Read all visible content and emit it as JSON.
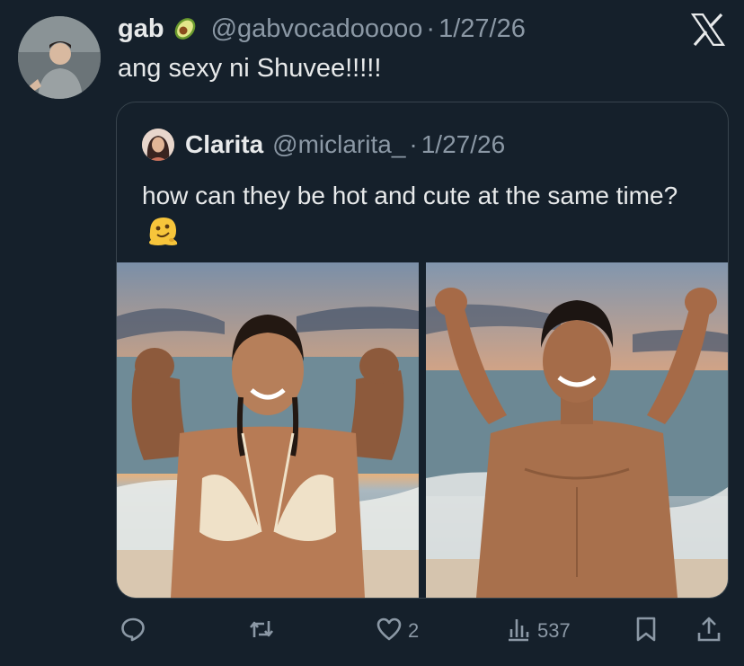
{
  "tweet": {
    "author_name": "gab",
    "handle": "@gabvocadooooo",
    "separator": "·",
    "date": "1/27/26",
    "text": "ang sexy ni Shuvee!!!!!"
  },
  "quoted": {
    "author_name": "Clarita",
    "handle": "@miclarita_",
    "separator": "·",
    "date": "1/27/26",
    "text": "how can they be hot and cute at the same time?",
    "emoji": "melting-face"
  },
  "actions": {
    "reply_count": "",
    "retweet_count": "",
    "like_count": "2",
    "views_count": "537"
  },
  "icons": [
    "avocado-icon",
    "x-logo-icon",
    "reply-icon",
    "retweet-icon",
    "heart-icon",
    "views-icon",
    "bookmark-icon",
    "share-icon",
    "melting-face-icon"
  ],
  "colors": {
    "background": "#15202b",
    "text": "#e7e9ea",
    "secondary_text": "#8b98a5",
    "border": "#38444d"
  }
}
